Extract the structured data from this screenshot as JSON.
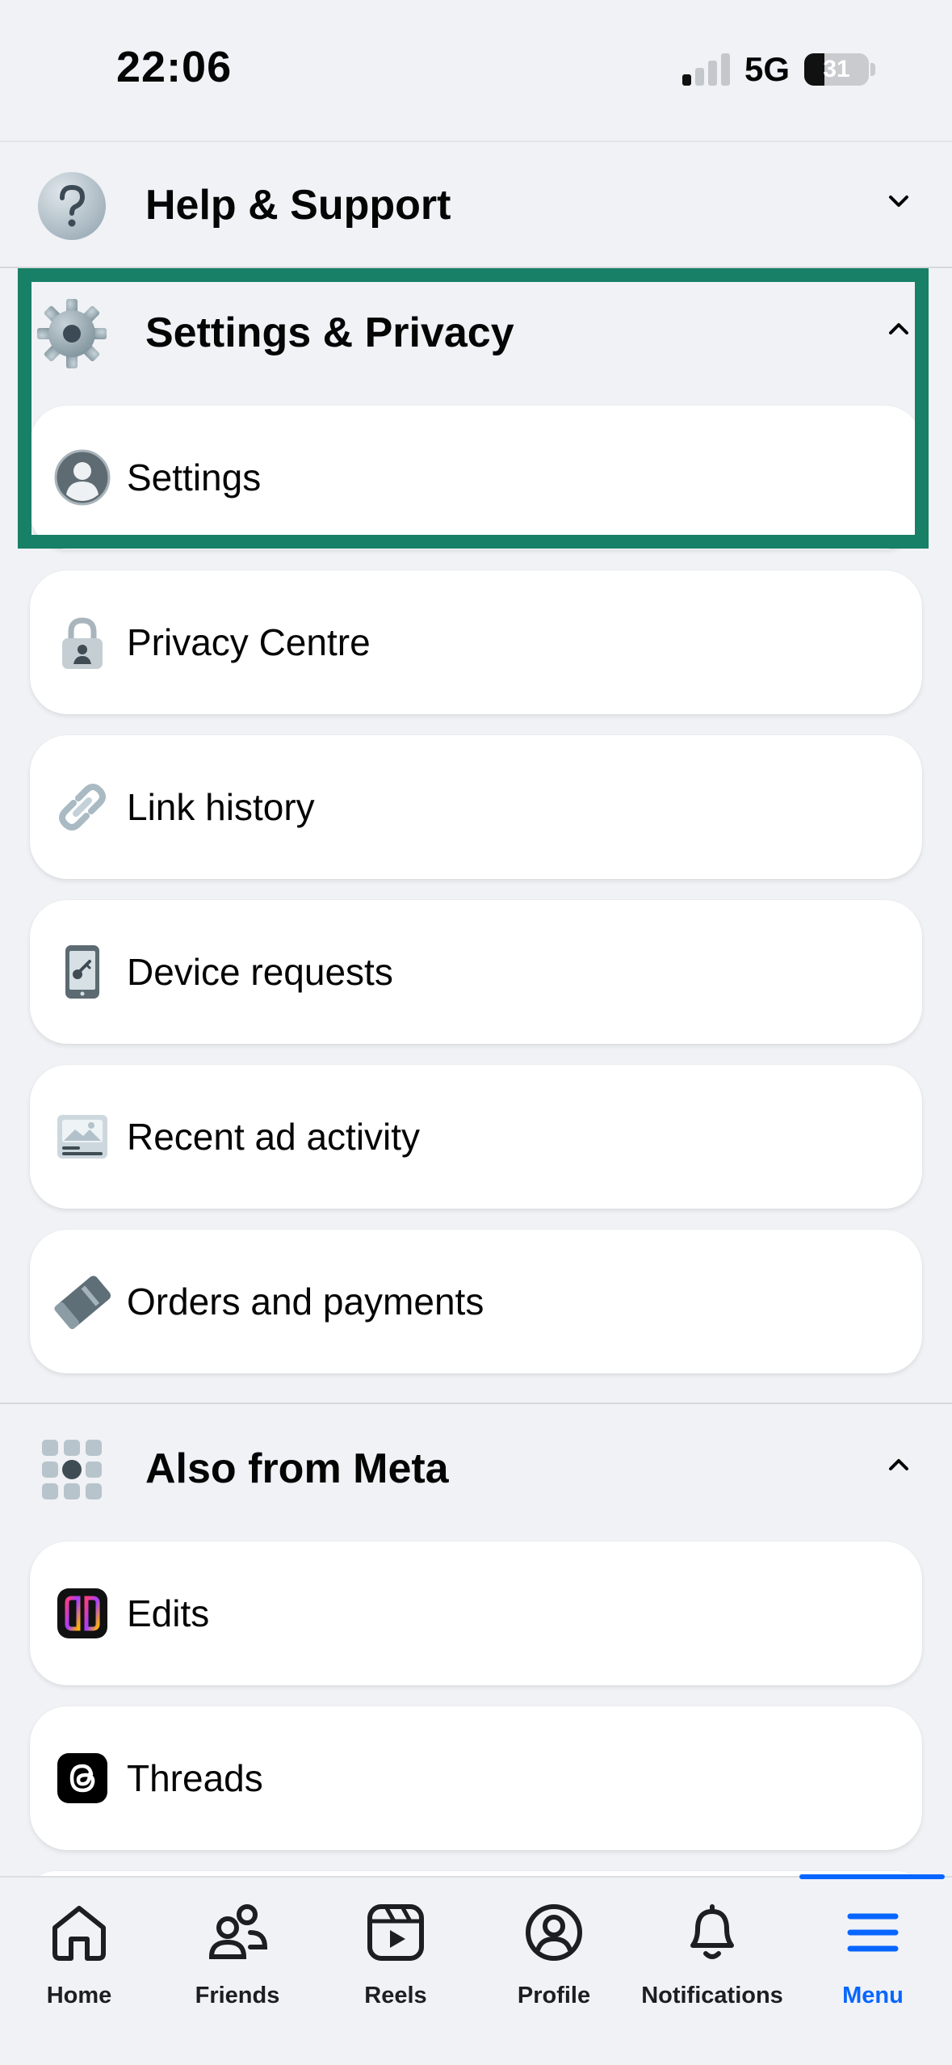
{
  "status_bar": {
    "time": "22:06",
    "network": "5G",
    "battery": "31",
    "battery_level": 0.31
  },
  "sections": {
    "help": {
      "title": "Help & Support",
      "expanded": false
    },
    "settings_privacy": {
      "title": "Settings & Privacy",
      "expanded": true,
      "items": [
        {
          "label": "Settings",
          "icon": "profile-circle-icon"
        },
        {
          "label": "Privacy Centre",
          "icon": "lock-icon"
        },
        {
          "label": "Link history",
          "icon": "link-icon"
        },
        {
          "label": "Device requests",
          "icon": "phone-key-icon"
        },
        {
          "label": "Recent ad activity",
          "icon": "ad-activity-icon"
        },
        {
          "label": "Orders and payments",
          "icon": "payment-card-icon"
        }
      ]
    },
    "also_from_meta": {
      "title": "Also from Meta",
      "expanded": true,
      "items": [
        {
          "label": "Edits",
          "icon": "edits-app-icon"
        },
        {
          "label": "Threads",
          "icon": "threads-app-icon"
        }
      ]
    }
  },
  "bottom_nav": {
    "items": [
      {
        "label": "Home",
        "icon": "home-icon"
      },
      {
        "label": "Friends",
        "icon": "friends-icon"
      },
      {
        "label": "Reels",
        "icon": "reels-icon"
      },
      {
        "label": "Profile",
        "icon": "profile-icon"
      },
      {
        "label": "Notifications",
        "icon": "bell-icon"
      },
      {
        "label": "Menu",
        "icon": "menu-icon",
        "active": true
      }
    ]
  },
  "colors": {
    "accent": "#0866ff",
    "highlight": "#188066",
    "background": "#f0f2f5"
  }
}
